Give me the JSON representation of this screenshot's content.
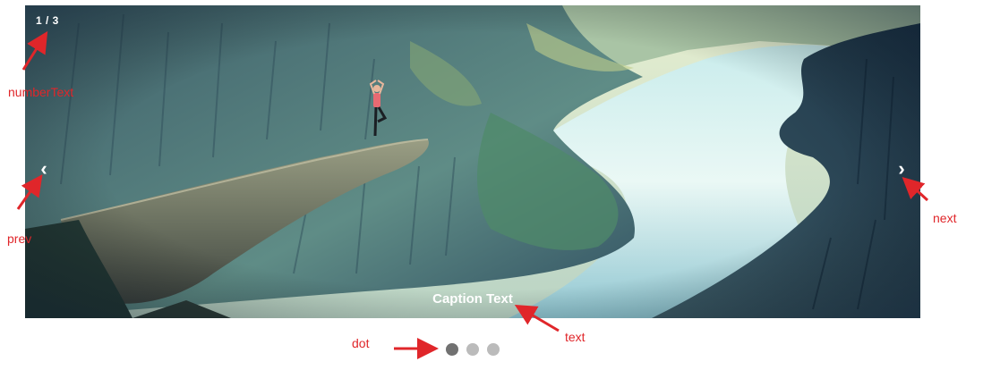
{
  "slideshow": {
    "number_text": "1 / 3",
    "prev_glyph": "‹",
    "next_glyph": "›",
    "caption": "Caption Text",
    "dots": [
      {
        "active": true
      },
      {
        "active": false
      },
      {
        "active": false
      }
    ]
  },
  "annotations": {
    "number_text_label": "numberText",
    "prev_label": "prev",
    "next_label": "next",
    "text_label": "text",
    "dot_label": "dot"
  },
  "colors": {
    "annotation": "#e0262a",
    "dot_active": "#717171",
    "dot_inactive": "#bbbbbb",
    "caption": "#ffffff"
  }
}
